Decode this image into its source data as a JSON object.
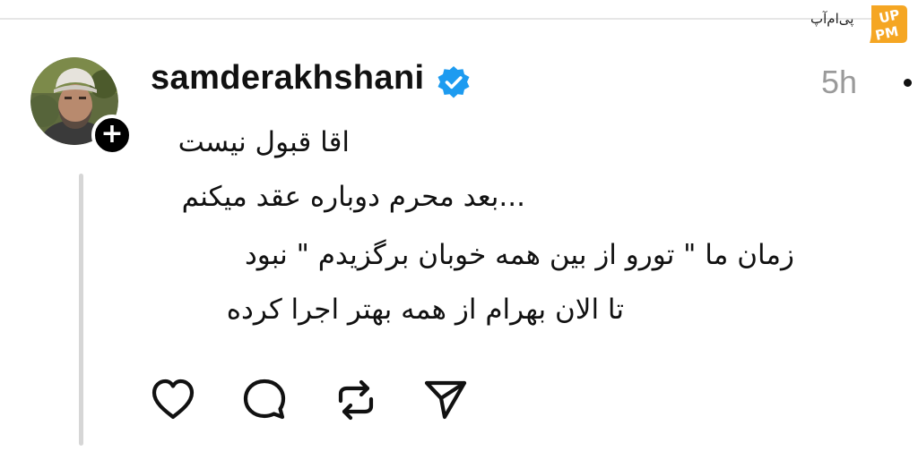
{
  "watermark": {
    "text": "پی‌ام‌آپ",
    "logo_text": "PMUP",
    "logo_color": "#f5a623"
  },
  "post": {
    "username": "samderakhshani",
    "verified": true,
    "verified_color": "#1d9bf0",
    "timestamp": "5h",
    "lines": [
      "اقا قبول نیست",
      "...بعد محرم دوباره عقد میکنم",
      "زمان ما \" تورو از بین همه خوبان برگزیدم \" نبود",
      "تا الان  بهرام از همه بهتر اجرا کرده"
    ]
  },
  "actions": [
    {
      "name": "like",
      "icon": "heart-icon"
    },
    {
      "name": "comment",
      "icon": "comment-bubble-icon"
    },
    {
      "name": "repost",
      "icon": "repost-icon"
    },
    {
      "name": "share",
      "icon": "send-icon"
    }
  ],
  "avatar": {
    "follow_badge": "+"
  }
}
